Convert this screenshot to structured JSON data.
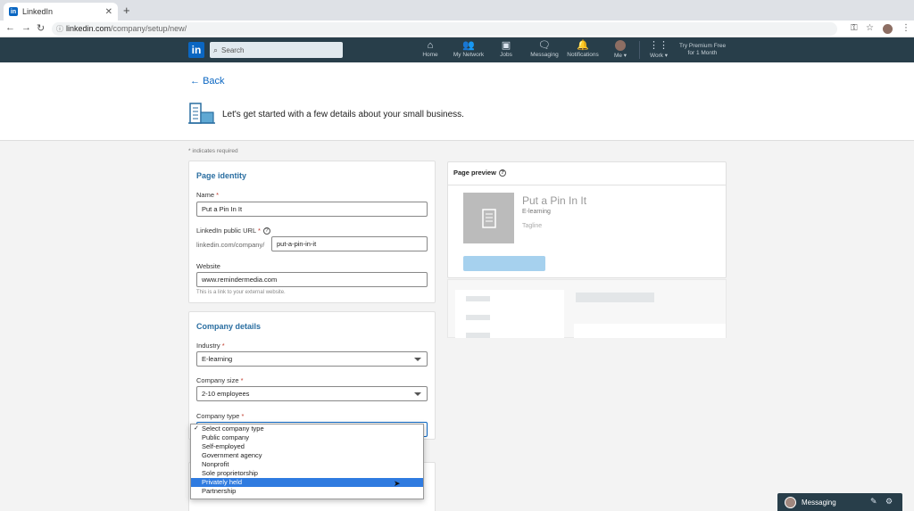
{
  "browser": {
    "tab_title": "LinkedIn",
    "tab_favicon": "in",
    "url_host": "linkedin.com",
    "url_path": "/company/setup/new/"
  },
  "nav": {
    "logo": "in",
    "search_placeholder": "Search",
    "items": [
      {
        "label": "Home",
        "icon": "home-icon"
      },
      {
        "label": "My Network",
        "icon": "network-icon"
      },
      {
        "label": "Jobs",
        "icon": "jobs-icon"
      },
      {
        "label": "Messaging",
        "icon": "messaging-icon"
      },
      {
        "label": "Notifications",
        "icon": "bell-icon"
      },
      {
        "label": "Me ▾",
        "icon": "avatar"
      },
      {
        "label": "Work ▾",
        "icon": "grid-icon"
      }
    ],
    "premium_line1": "Try Premium Free",
    "premium_line2": "for 1 Month"
  },
  "header": {
    "back_label": "Back",
    "intro": "Let's get started with a few details about your small business."
  },
  "form": {
    "required_note": "* indicates required",
    "identity_title": "Page identity",
    "name_label": "Name",
    "name_value": "Put a Pin In It",
    "url_label": "LinkedIn public URL",
    "url_prefix": "linkedin.com/company/",
    "url_value": "put-a-pin-in-it",
    "website_label": "Website",
    "website_value": "www.remindermedia.com",
    "website_help": "This is a link to your external website.",
    "company_title": "Company details",
    "industry_label": "Industry",
    "industry_value": "E-learning",
    "size_label": "Company size",
    "size_value": "2-10 employees",
    "type_label": "Company type",
    "type_options": [
      "Select company type",
      "Public company",
      "Self-employed",
      "Government agency",
      "Nonprofit",
      "Sole proprietorship",
      "Privately held",
      "Partnership"
    ],
    "type_selected_index": 0,
    "type_highlight_index": 6
  },
  "preview": {
    "title": "Page preview",
    "name": "Put a Pin In It",
    "industry": "E-learning",
    "tagline": "Tagline"
  },
  "messaging": {
    "label": "Messaging"
  }
}
